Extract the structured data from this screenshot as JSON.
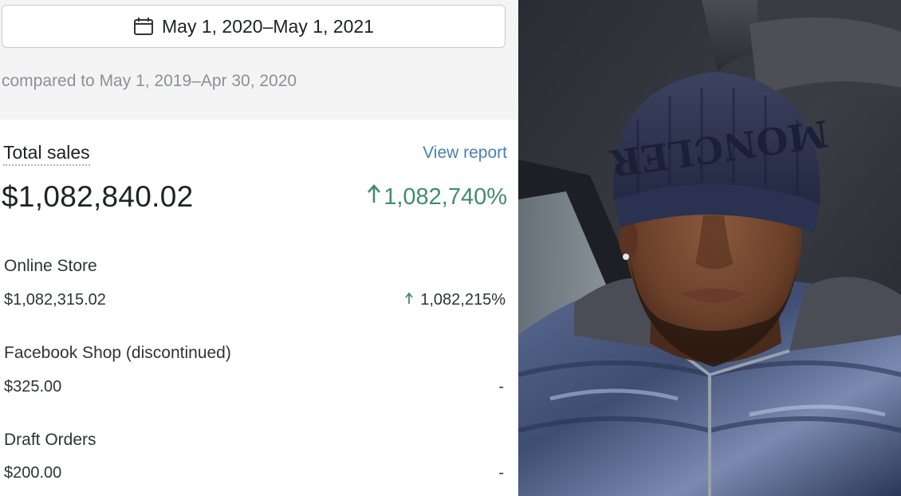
{
  "date_range": {
    "icon": "calendar-icon",
    "label": "May 1, 2020–May 1, 2021"
  },
  "comparison": {
    "label": "compared to May 1, 2019–Apr 30, 2020"
  },
  "total_sales": {
    "label": "Total sales",
    "view_report": "View report",
    "value": "$1,082,840.02",
    "change": "1,082,740%",
    "change_direction": "up",
    "change_color": "#3e8e6a"
  },
  "channels": [
    {
      "label": "Online Store",
      "value": "$1,082,315.02",
      "change": "1,082,215%",
      "change_direction": "up"
    },
    {
      "label": "Facebook Shop (discontinued)",
      "value": "$325.00",
      "change": "-"
    },
    {
      "label": "Draft Orders",
      "value": "$200.00",
      "change": "-"
    }
  ],
  "video_frame": {
    "hat_text": "MONCLER"
  }
}
